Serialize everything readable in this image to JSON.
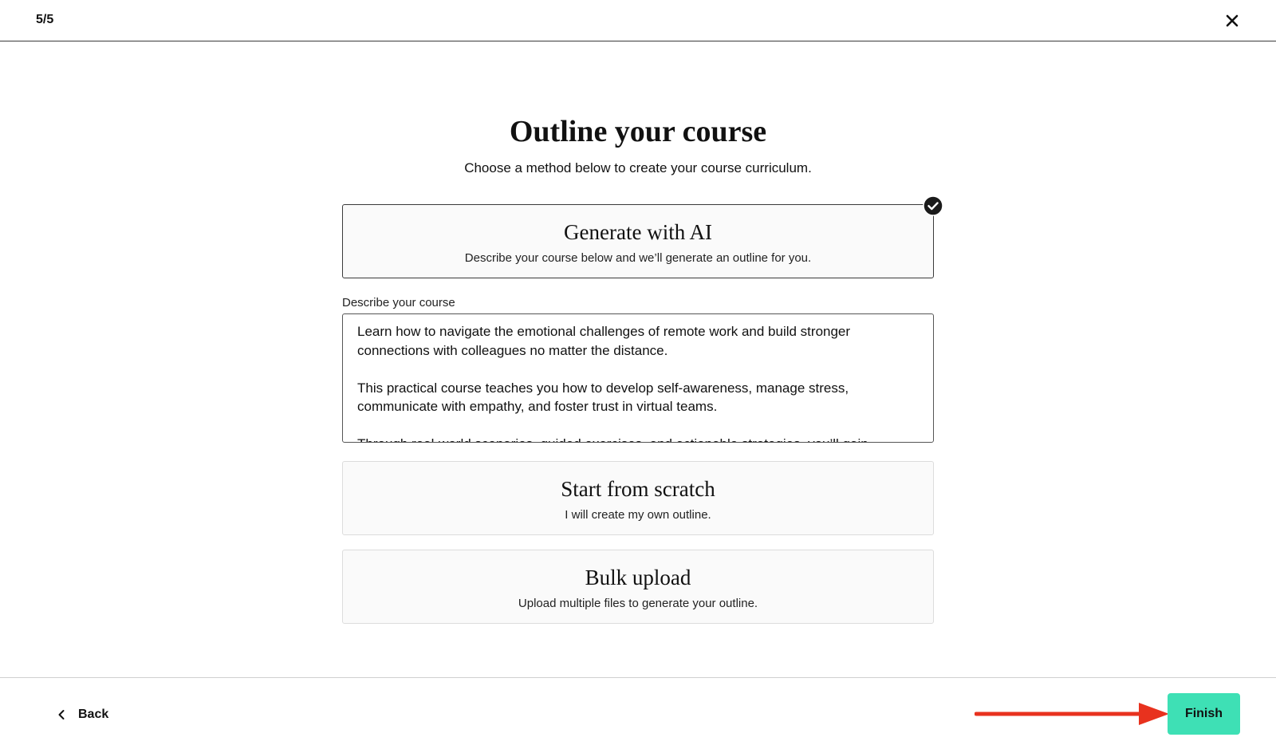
{
  "header": {
    "step": "5/5",
    "close_icon": "close-icon"
  },
  "main": {
    "title": "Outline your course",
    "subtitle": "Choose a method below to create your course curriculum.",
    "options": [
      {
        "title": "Generate with AI",
        "description": "Describe your course below and we’ll generate an outline for you.",
        "selected": true
      },
      {
        "title": "Start from scratch",
        "description": "I will create my own outline.",
        "selected": false
      },
      {
        "title": "Bulk upload",
        "description": "Upload multiple files to generate your outline.",
        "selected": false
      }
    ],
    "describe": {
      "label": "Describe your course",
      "value": "Learn how to navigate the emotional challenges of remote work and build stronger connections with colleagues no matter the distance.\n\nThis practical course teaches you how to develop self-awareness, manage stress, communicate with empathy, and foster trust in virtual teams.\n\nThrough real-world scenarios, guided exercises, and actionable strategies, you’ll gain"
    }
  },
  "footer": {
    "back_label": "Back",
    "finish_label": "Finish"
  },
  "colors": {
    "finish_button": "#3ee0b5",
    "annotation_arrow": "#e8321e",
    "selected_border": "#3a3a3a"
  }
}
